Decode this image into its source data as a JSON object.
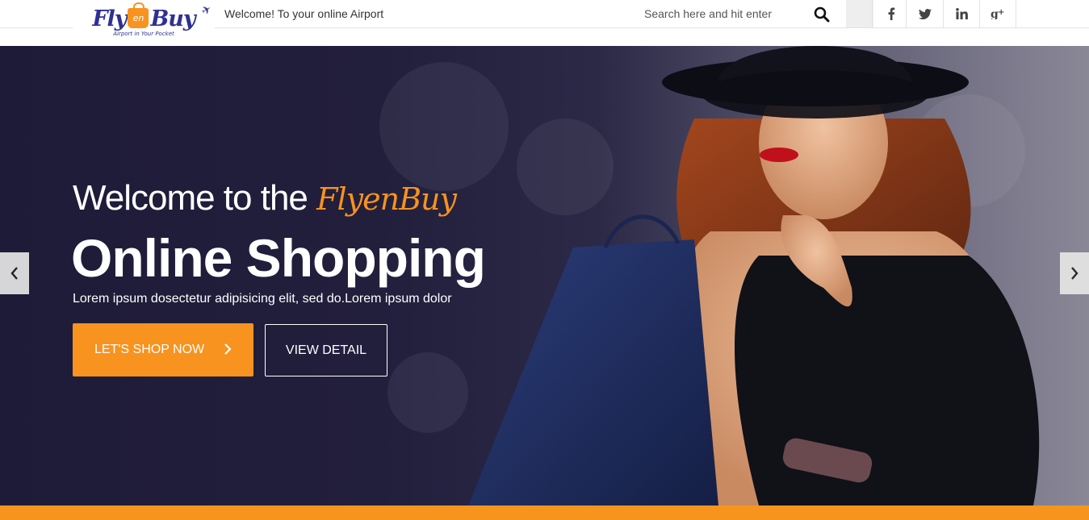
{
  "header": {
    "logo": {
      "word_left": "Fly",
      "bag_text": "en",
      "word_right": "Buy",
      "tagline": "Airport in Your Pocket"
    },
    "welcome_text": "Welcome! To your online Airport",
    "search": {
      "placeholder": "Search here and hit enter"
    },
    "social": [
      {
        "name": "facebook-icon",
        "glyph": "f"
      },
      {
        "name": "twitter-icon",
        "glyph": "t"
      },
      {
        "name": "linkedin-icon",
        "glyph": "in"
      },
      {
        "name": "google-plus-icon",
        "glyph": "g+"
      }
    ]
  },
  "hero": {
    "heading_prefix": "Welcome to the",
    "heading_brand": "FlyenBuy",
    "title": "Online Shopping",
    "subtitle": "Lorem ipsum dosectetur adipisicing elit, sed do.Lorem ipsum dolor",
    "primary_button": "LET'S SHOP NOW",
    "secondary_button": "VIEW DETAIL"
  },
  "colors": {
    "accent": "#f7931e",
    "brand_blue": "#2e3192",
    "hero_bg": "#221f3d"
  }
}
